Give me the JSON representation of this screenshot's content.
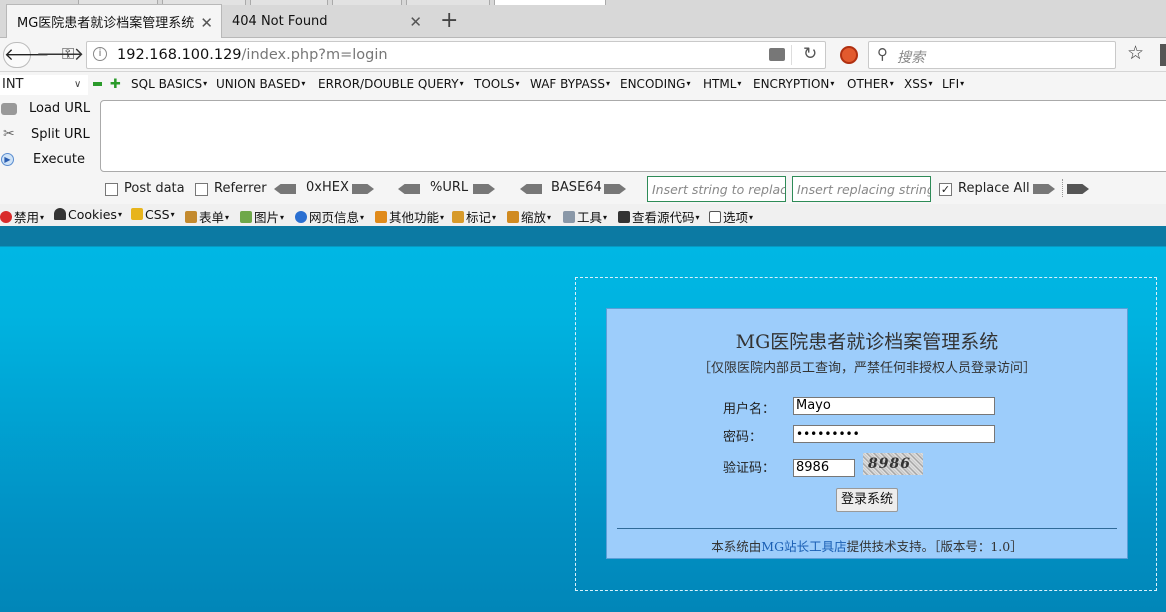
{
  "browser": {
    "tabs": [
      {
        "label": "MG医院患者就诊档案管理系统",
        "active": true
      },
      {
        "label": "404 Not Found",
        "active": false
      }
    ],
    "new_tab": "+",
    "url_host": "192.168.100.129",
    "url_path": "/index.php?m=login",
    "search_placeholder": "搜索"
  },
  "hackbar": {
    "select_value": "INT",
    "menus": [
      "SQL BASICS",
      "UNION BASED",
      "ERROR/DOUBLE QUERY",
      "TOOLS",
      "WAF BYPASS",
      "ENCODING",
      "HTML",
      "ENCRYPTION",
      "OTHER",
      "XSS",
      "LFI"
    ],
    "actions": {
      "load": "Load URL",
      "split": "Split URL",
      "execute": "Execute"
    },
    "options": {
      "post": "Post data",
      "referrer": "Referrer",
      "hex": "0xHEX",
      "url": "%URL",
      "base64": "BASE64",
      "replace_all": "Replace All"
    },
    "replace_placeholder": "Insert string to replace",
    "replacing_placeholder": "Insert replacing string"
  },
  "webdev": [
    "禁用",
    "Cookies",
    "CSS",
    "表单",
    "图片",
    "网页信息",
    "其他功能",
    "标记",
    "缩放",
    "工具",
    "查看源代码",
    "选项"
  ],
  "login": {
    "title": "MG医院患者就诊档案管理系统",
    "notice": "［仅限医院内部员工查询，严禁任何非授权人员登录访问］",
    "username_label": "用户名：",
    "username_value": "Mayo",
    "password_label": "密码：",
    "password_value": "•••••••••",
    "captcha_label": "验证码：",
    "captcha_value": "8986",
    "captcha_image_text": "8986",
    "submit": "登录系统",
    "footer_pre": "本系统由",
    "footer_link": "MG站长工具店",
    "footer_post": "提供技术支持。［版本号：1.0］"
  },
  "colors": {
    "page_bg": "#00b7e4",
    "panel_bg": "#9dcdfb",
    "link": "#1a5fb4"
  }
}
